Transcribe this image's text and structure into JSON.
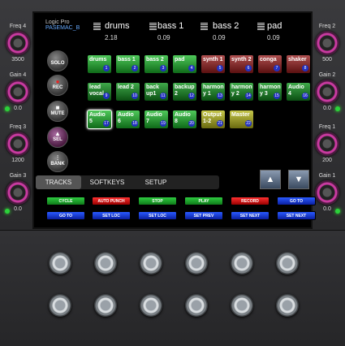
{
  "knobs_left": [
    {
      "label": "Freq 4",
      "value": "3500"
    },
    {
      "label": "Gain 4",
      "value": "0.0"
    },
    {
      "label": "Freq 3",
      "value": "1200"
    },
    {
      "label": "Gain 3",
      "value": "0.0"
    }
  ],
  "knobs_right": [
    {
      "label": "Freq 2",
      "value": "500"
    },
    {
      "label": "Gain 2",
      "value": "0.0"
    },
    {
      "label": "Freq 1",
      "value": "200"
    },
    {
      "label": "Gain 1",
      "value": "0.0"
    }
  ],
  "logo": {
    "line1": "Logic Pro",
    "line2": "PASEMAC_B"
  },
  "channels": [
    {
      "name": "drums",
      "value": "2.18"
    },
    {
      "name": "bass 1",
      "value": "0.09"
    },
    {
      "name": "bass 2",
      "value": "0.09"
    },
    {
      "name": "pad",
      "value": "0.09"
    }
  ],
  "side_buttons": [
    {
      "label": "SOLO",
      "icon": ""
    },
    {
      "label": "REC",
      "icon": "●"
    },
    {
      "label": "MUTE",
      "icon": "■"
    },
    {
      "label": "SEL",
      "icon": "▲"
    },
    {
      "label": "BANK",
      "icon": "⫶"
    }
  ],
  "tracks": [
    {
      "label": "drums",
      "num": "1",
      "color": "green"
    },
    {
      "label": "bass 1",
      "num": "2",
      "color": "green"
    },
    {
      "label": "bass 2",
      "num": "3",
      "color": "green"
    },
    {
      "label": "pad",
      "num": "4",
      "color": "green"
    },
    {
      "label": "synth 1",
      "num": "5",
      "color": "red"
    },
    {
      "label": "synth 2",
      "num": "6",
      "color": "red"
    },
    {
      "label": "conga",
      "num": "7",
      "color": "red"
    },
    {
      "label": "shaker",
      "num": "8",
      "color": "red"
    },
    {
      "label": "lead vocal",
      "num": "9",
      "color": "dkgreen"
    },
    {
      "label": "lead 2",
      "num": "10",
      "color": "dkgreen"
    },
    {
      "label": "back up1",
      "num": "11",
      "color": "dkgreen"
    },
    {
      "label": "backup 2",
      "num": "12",
      "color": "dkgreen"
    },
    {
      "label": "harmon y 1",
      "num": "13",
      "color": "dkgreen"
    },
    {
      "label": "harmon y 2",
      "num": "14",
      "color": "dkgreen"
    },
    {
      "label": "harmon y 3",
      "num": "15",
      "color": "dkgreen"
    },
    {
      "label": "Audio 4",
      "num": "16",
      "color": "dkgreen"
    },
    {
      "label": "Audio 5",
      "num": "17",
      "color": "green"
    },
    {
      "label": "Audio 6",
      "num": "18",
      "color": "green"
    },
    {
      "label": "Audio 7",
      "num": "19",
      "color": "green"
    },
    {
      "label": "Audio 8",
      "num": "20",
      "color": "green"
    },
    {
      "label": "Output 1-2",
      "num": "21",
      "color": "yellow"
    },
    {
      "label": "Master",
      "num": "22",
      "color": "yellow"
    }
  ],
  "selected_track": "Audio 5",
  "tabs": [
    "TRACKS",
    "SOFTKEYS",
    "SETUP"
  ],
  "active_tab": "TRACKS",
  "arrows": {
    "up": "▲",
    "down": "▼"
  },
  "transport_row1": [
    {
      "label": "CYCLE",
      "color": "green"
    },
    {
      "label": "AUTO PUNCH",
      "color": "red"
    },
    {
      "label": "STOP",
      "color": "green"
    },
    {
      "label": "PLAY",
      "color": "green"
    },
    {
      "label": "RECORD",
      "color": "red"
    },
    {
      "label": "GO TO",
      "color": "blue"
    }
  ],
  "transport_row2": [
    {
      "label": "GO TO",
      "color": "blue"
    },
    {
      "label": "SET LOC",
      "color": "blue"
    },
    {
      "label": "SET LOC",
      "color": "blue"
    },
    {
      "label": "SET PREV",
      "color": "blue"
    },
    {
      "label": "SET NEXT",
      "color": "blue"
    },
    {
      "label": "SET NEXT",
      "color": "blue"
    }
  ],
  "colors": {
    "knob_ring": "#c93aa0",
    "led": "#2bd23a",
    "track_green": "#1f9a2a",
    "track_red": "#8a2a2a",
    "transport_blue": "#2a5aff"
  }
}
